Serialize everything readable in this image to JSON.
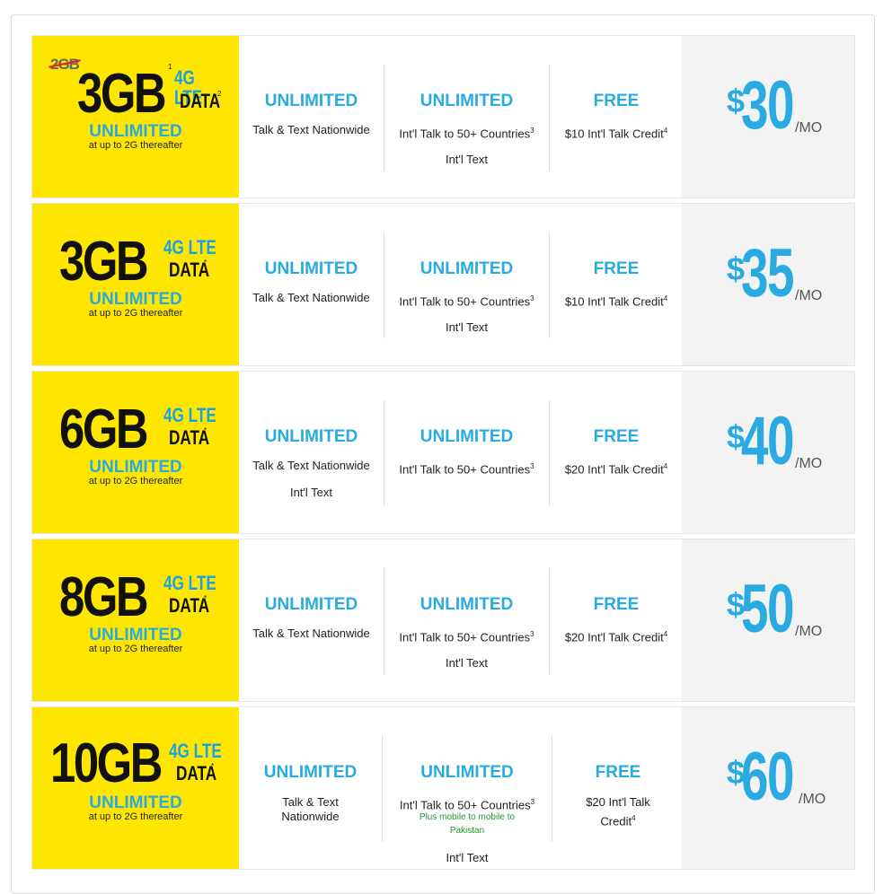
{
  "plans": [
    {
      "data_amount": "3GB",
      "old_amount": "2GB",
      "data_sup": "1",
      "lte_label": "4G LTE",
      "data_label": "DATA",
      "data_label_sup": "2",
      "unlimited_label": "UNLIMITED",
      "after_label": "at up to 2G thereafter",
      "talk_header": "UNLIMITED",
      "talk_text": "Talk & Text Nationwide",
      "intl_header": "UNLIMITED",
      "intl_text": "Int'l Talk to 50+ Countries",
      "intl_sup": "3",
      "intl_text2": "Int'l Text",
      "credit_header": "FREE",
      "credit_text": "$10 Int'l Talk Credit",
      "credit_sup": "4",
      "price_symbol": "$",
      "price": "30",
      "price_unit": "/MO"
    },
    {
      "data_amount": "3GB",
      "lte_label": "4G LTE",
      "data_label": "DATA",
      "data_label_sup": "*",
      "unlimited_label": "UNLIMITED",
      "after_label": "at up to 2G thereafter",
      "talk_header": "UNLIMITED",
      "talk_text": "Talk & Text Nationwide",
      "intl_header": "UNLIMITED",
      "intl_text": "Int'l Talk to 50+ Countries",
      "intl_sup": "3",
      "intl_text2": "Int'l Text",
      "credit_header": "FREE",
      "credit_text": "$10 Int'l Talk Credit",
      "credit_sup": "4",
      "price_symbol": "$",
      "price": "35",
      "price_unit": "/MO"
    },
    {
      "data_amount": "6GB",
      "lte_label": "4G LTE",
      "data_label": "DATA",
      "data_label_sup": "*",
      "unlimited_label": "UNLIMITED",
      "after_label": "at up to 2G thereafter",
      "talk_header": "UNLIMITED",
      "talk_text": "Talk & Text Nationwide",
      "talk_text2": "Int'l Text",
      "intl_header": "UNLIMITED",
      "intl_text": "Int'l Talk to 50+ Countries",
      "intl_sup": "3",
      "credit_header": "FREE",
      "credit_text": "$20 Int'l Talk Credit",
      "credit_sup": "4",
      "price_symbol": "$",
      "price": "40",
      "price_unit": "/MO"
    },
    {
      "data_amount": "8GB",
      "lte_label": "4G LTE",
      "data_label": "DATA",
      "data_label_sup": "*",
      "unlimited_label": "UNLIMITED",
      "after_label": "at up to 2G thereafter",
      "talk_header": "UNLIMITED",
      "talk_text": "Talk & Text Nationwide",
      "intl_header": "UNLIMITED",
      "intl_text": "Int'l Talk to 50+ Countries",
      "intl_sup": "3",
      "intl_text2": "Int'l Text",
      "credit_header": "FREE",
      "credit_text": "$20 Int'l Talk Credit",
      "credit_sup": "4",
      "price_symbol": "$",
      "price": "50",
      "price_unit": "/MO"
    },
    {
      "data_amount": "10GB",
      "lte_label": "4G LTE",
      "data_label": "DATA",
      "data_label_sup": "*",
      "unlimited_label": "UNLIMITED",
      "after_label": "at up to 2G thereafter",
      "talk_header": "UNLIMITED",
      "talk_text": "Talk & Text",
      "talk_text_b": "Nationwide",
      "intl_header": "UNLIMITED",
      "intl_text": "Int'l Talk to 50+ Countries",
      "intl_sup": "3",
      "intl_promo": "Plus mobile to mobile to",
      "intl_promo2": "Pakistan",
      "intl_text2": "Int'l Text",
      "credit_header": "FREE",
      "credit_text": "$20 Int'l Talk",
      "credit_text_b": "Credit",
      "credit_sup": "4",
      "price_symbol": "$",
      "price": "60",
      "price_unit": "/MO"
    }
  ]
}
